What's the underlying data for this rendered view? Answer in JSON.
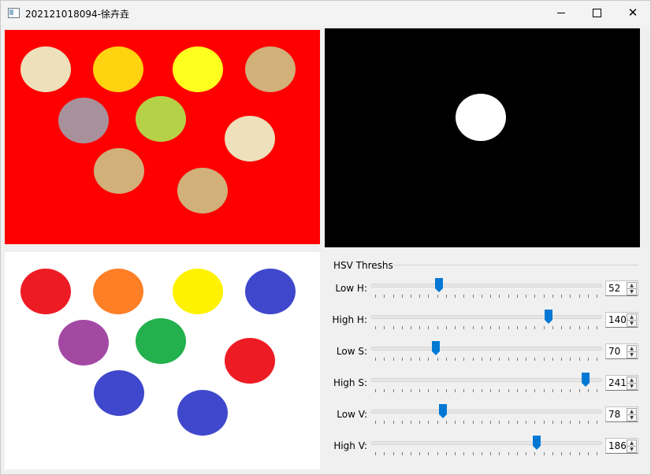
{
  "window": {
    "title": "202121018094-徐卉垚",
    "controls": {
      "minimize": "minimize",
      "maximize": "maximize",
      "close": "✕"
    }
  },
  "images": {
    "source": {
      "background": "#ff0000",
      "circles": [
        "#ede0bb",
        "#ffd30f",
        "#ffff1f",
        "#d1b07a",
        "#a9919c",
        "#b5d147",
        "#ede0bb",
        "#d1b07a",
        "#d1b07a"
      ]
    },
    "mask": {
      "background": "#000000",
      "blob": "#ffffff"
    },
    "result": {
      "background": "#ffffff",
      "circles": [
        "#ed1c24",
        "#ff7f27",
        "#fff200",
        "#3f48cc",
        "#a349a4",
        "#22b14c",
        "#ed1c24",
        "#3f48cc",
        "#3f48cc"
      ]
    }
  },
  "hsv": {
    "group_title": "HSV Threshs",
    "sliders": [
      {
        "label": "Low H:",
        "value": "52",
        "fraction": 0.295
      },
      {
        "label": "High H:",
        "value": "140",
        "fraction": 0.774
      },
      {
        "label": "Low S:",
        "value": "70",
        "fraction": 0.281
      },
      {
        "label": "High S:",
        "value": "241",
        "fraction": 0.935
      },
      {
        "label": "Low V:",
        "value": "78",
        "fraction": 0.313
      },
      {
        "label": "High V:",
        "value": "186",
        "fraction": 0.72
      }
    ]
  },
  "colors": {
    "accent": "#0078d4"
  }
}
